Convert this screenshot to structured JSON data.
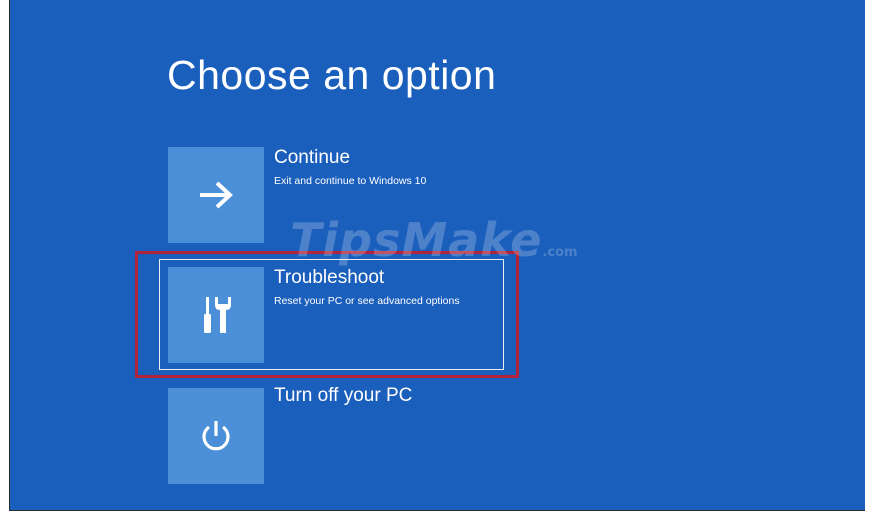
{
  "screen": {
    "title": "Choose an option",
    "background_color": "#1b5fbd",
    "tile_color": "#4a8fd8",
    "annotation_color": "#b0233a"
  },
  "options": [
    {
      "id": "continue",
      "title": "Continue",
      "description": "Exit and continue to Windows 10",
      "icon": "arrow-right-icon"
    },
    {
      "id": "troubleshoot",
      "title": "Troubleshoot",
      "description": "Reset your PC or see advanced options",
      "icon": "screwdriver-wrench-icon",
      "highlighted": true
    },
    {
      "id": "turn-off",
      "title": "Turn off your PC",
      "description": "",
      "icon": "power-icon"
    }
  ],
  "watermark": {
    "brand": "TipsMake",
    "suffix": ".com"
  }
}
